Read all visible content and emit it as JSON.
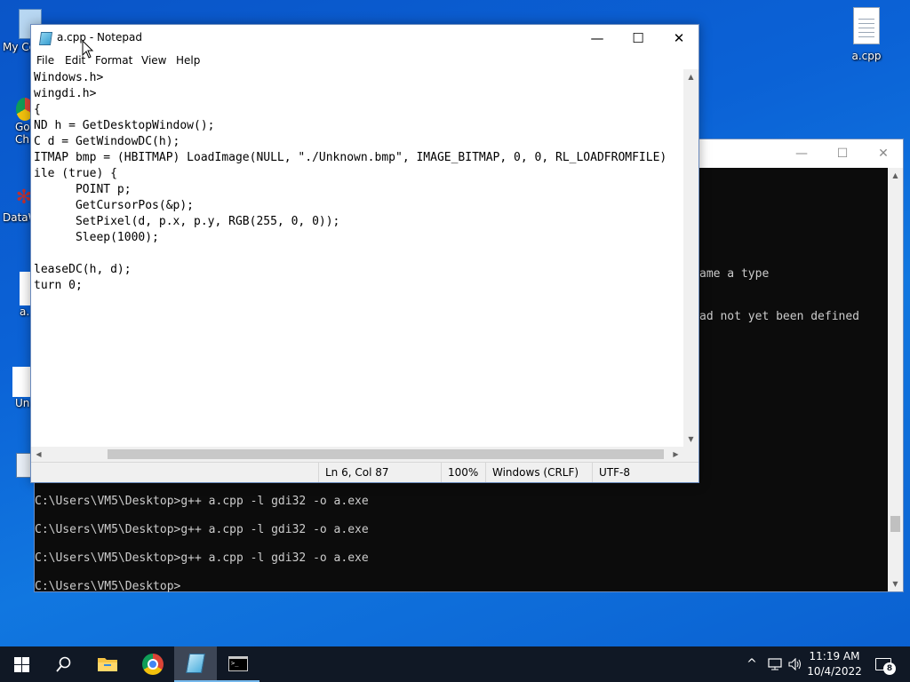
{
  "desktop": {
    "icons_left": [
      {
        "label": "My Co",
        "icon": "computer-icon"
      },
      {
        "label": "Go Ch",
        "icon": "chrome-icon"
      },
      {
        "label": "DataW",
        "icon": "app-icon"
      },
      {
        "label": "a.",
        "icon": "exe-icon"
      },
      {
        "label": "Un",
        "icon": "file-icon"
      },
      {
        "label": "",
        "icon": "app-icon"
      }
    ],
    "icon_right": {
      "label": "a.cpp",
      "icon": "text-file-icon"
    }
  },
  "console": {
    "partial_lines": [
      "ame a type",
      "ad not yet been defined"
    ],
    "lines": [
      "C:\\Users\\VM5\\Desktop>g++ a.cpp -l gdi32 -o a.exe",
      "C:\\Users\\VM5\\Desktop>g++ a.cpp -l gdi32 -o a.exe",
      "C:\\Users\\VM5\\Desktop>g++ a.cpp -l gdi32 -o a.exe",
      "C:\\Users\\VM5\\Desktop>"
    ],
    "controls": {
      "minimize": "—",
      "maximize": "☐",
      "close": "✕"
    }
  },
  "notepad": {
    "title": "a.cpp - Notepad",
    "controls": {
      "minimize": "—",
      "maximize": "☐",
      "close": "✕"
    },
    "menu": [
      "File",
      "Edit",
      "Format",
      "View",
      "Help"
    ],
    "code_lines": [
      "Windows.h>",
      "wingdi.h>",
      "{",
      "ND h = GetDesktopWindow();",
      "C d = GetWindowDC(h);",
      "ITMAP bmp = (HBITMAP) LoadImage(NULL, \"./Unknown.bmp\", IMAGE_BITMAP, 0, 0, RL_LOADFROMFILE)",
      "ile (true) {",
      "      POINT p;",
      "      GetCursorPos(&p);",
      "      SetPixel(d, p.x, p.y, RGB(255, 0, 0));",
      "      Sleep(1000);",
      "",
      "leaseDC(h, d);",
      "turn 0;"
    ],
    "status": {
      "position": "Ln 6, Col 87",
      "zoom": "100%",
      "line_endings": "Windows (CRLF)",
      "encoding": "UTF-8"
    }
  },
  "taskbar": {
    "apps": [
      {
        "name": "start-button",
        "icon": "windows-logo-icon"
      },
      {
        "name": "search-button",
        "icon": "search-icon"
      },
      {
        "name": "file-explorer",
        "icon": "folder-icon"
      },
      {
        "name": "chrome",
        "icon": "chrome-icon"
      },
      {
        "name": "notepad",
        "icon": "notepad-icon"
      },
      {
        "name": "cmd",
        "icon": "console-icon"
      }
    ],
    "clock": {
      "time": "11:19 AM",
      "date": "10/4/2022"
    },
    "notification_count": "8"
  },
  "colors": {
    "desktop_blue": "#0b62d6",
    "console_bg": "#0c0c0c",
    "console_text": "#cccccc",
    "taskbar_bg": "#101825",
    "accent": "#76b9ed"
  }
}
